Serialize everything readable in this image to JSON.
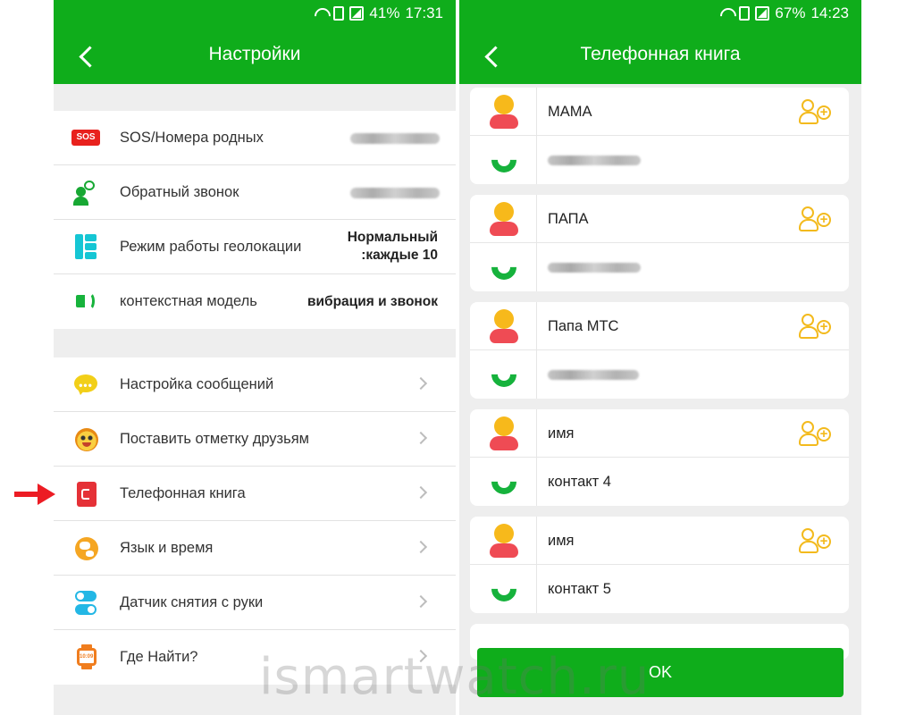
{
  "left_phone": {
    "status": {
      "battery": "41%",
      "time": "17:31"
    },
    "title": "Настройки",
    "group1": [
      {
        "label": "SOS/Номера родных",
        "icon": "sos-icon",
        "icon_text": "SOS"
      },
      {
        "label": "Обратный звонок",
        "icon": "callback-icon"
      },
      {
        "label": "Режим работы геолокации",
        "icon": "geolocation-icon",
        "value_line1": "Нормальный",
        "value_line2": ":каждые 10"
      },
      {
        "label": "контекстная модель",
        "icon": "sound-icon",
        "value": "вибрация и звонок"
      }
    ],
    "group2": [
      {
        "label": "Настройка сообщений",
        "icon": "message-icon",
        "icon_text": "•••"
      },
      {
        "label": "Поставить отметку друзьям",
        "icon": "friend-icon"
      },
      {
        "label": "Телефонная книга",
        "icon": "phonebook-icon"
      },
      {
        "label": "Язык и время",
        "icon": "globe-icon"
      },
      {
        "label": "Датчик снятия с руки",
        "icon": "toggle-sensor-icon"
      },
      {
        "label": "Где Найти?",
        "icon": "watch-icon",
        "icon_text": "10:09"
      }
    ]
  },
  "right_phone": {
    "status": {
      "battery": "67%",
      "time": "14:23"
    },
    "title": "Телефонная книга",
    "contacts": [
      {
        "name": "МАМА",
        "number": ""
      },
      {
        "name": "ПАПА",
        "number": ""
      },
      {
        "name": "Папа МТС",
        "number": ""
      },
      {
        "name": "имя",
        "number": "контакт 4"
      },
      {
        "name": "имя",
        "number": "контакт 5"
      }
    ],
    "ok_label": "OK"
  },
  "watermark": "ismartwatch.ru",
  "colors": {
    "header_green": "#0fad1b",
    "arrow_red": "#ec1c24",
    "avatar_yellow": "#f7b91b",
    "avatar_red": "#ef4b54"
  }
}
